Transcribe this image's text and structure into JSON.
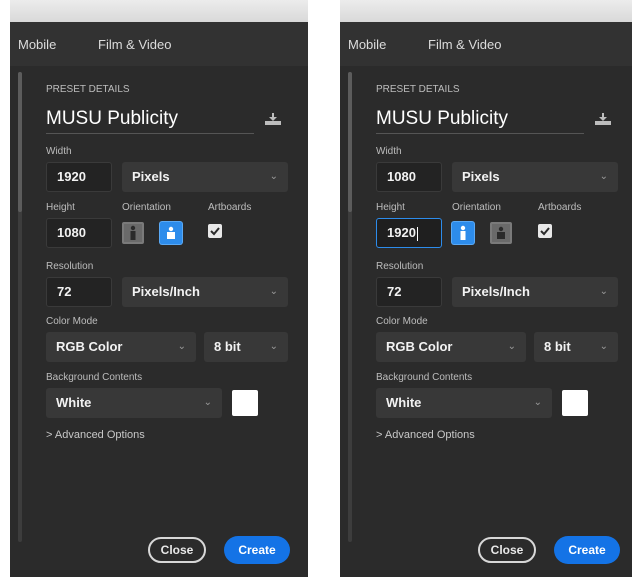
{
  "accent_color": "#2d8ceb",
  "panels": [
    {
      "tabs": [
        "Mobile",
        "Film & Video"
      ],
      "section_title": "PRESET DETAILS",
      "preset_name": "MUSU Publicity",
      "save_icon": "download-icon",
      "width_label": "Width",
      "width_value": "1920",
      "width_unit": "Pixels",
      "height_label": "Height",
      "height_value": "1080",
      "orientation_label": "Orientation",
      "orientation_selected": "landscape",
      "artboards_label": "Artboards",
      "artboards_checked": true,
      "resolution_label": "Resolution",
      "resolution_value": "72",
      "resolution_unit": "Pixels/Inch",
      "color_mode_label": "Color Mode",
      "color_mode": "RGB Color",
      "bit_depth": "8 bit",
      "background_label": "Background Contents",
      "background_value": "White",
      "background_color": "#ffffff",
      "advanced_label": "> Advanced Options",
      "close_label": "Close",
      "create_label": "Create"
    },
    {
      "tabs": [
        "Mobile",
        "Film & Video"
      ],
      "section_title": "PRESET DETAILS",
      "preset_name": "MUSU Publicity",
      "save_icon": "download-icon",
      "width_label": "Width",
      "width_value": "1080",
      "width_unit": "Pixels",
      "height_label": "Height",
      "height_value": "1920",
      "orientation_label": "Orientation",
      "orientation_selected": "portrait",
      "artboards_label": "Artboards",
      "artboards_checked": true,
      "resolution_label": "Resolution",
      "resolution_value": "72",
      "resolution_unit": "Pixels/Inch",
      "color_mode_label": "Color Mode",
      "color_mode": "RGB Color",
      "bit_depth": "8 bit",
      "background_label": "Background Contents",
      "background_value": "White",
      "background_color": "#ffffff",
      "advanced_label": "> Advanced Options",
      "close_label": "Close",
      "create_label": "Create"
    }
  ]
}
